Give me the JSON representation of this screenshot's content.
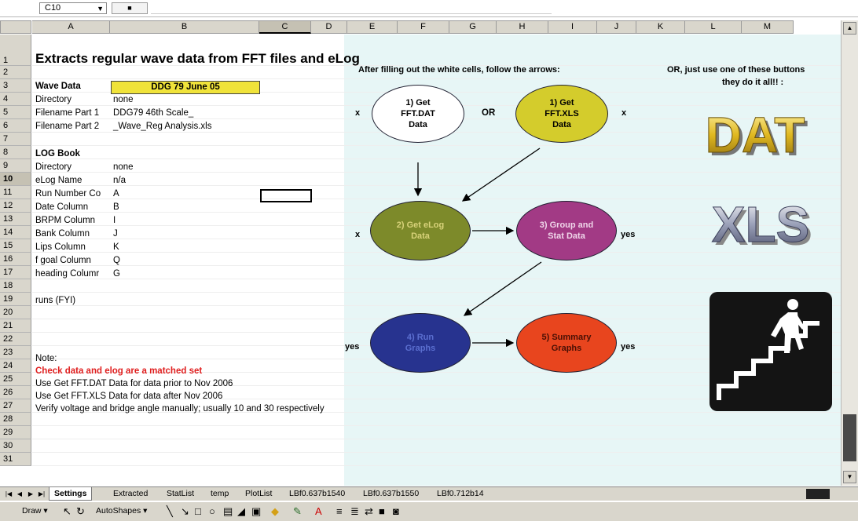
{
  "formula_bar": {
    "name_box": "C10"
  },
  "columns": [
    "A",
    "B",
    "C",
    "D",
    "E",
    "F",
    "G",
    "H",
    "I",
    "J",
    "K",
    "L",
    "M"
  ],
  "rows": [
    "1",
    "2",
    "3",
    "4",
    "5",
    "6",
    "7",
    "8",
    "9",
    "10",
    "11",
    "12",
    "13",
    "14",
    "15",
    "16",
    "17",
    "18",
    "19",
    "20",
    "21",
    "22",
    "23",
    "24",
    "25",
    "26",
    "27",
    "28",
    "29",
    "30",
    "31"
  ],
  "cells": {
    "title": "Extracts regular wave data from FFT files and eLog",
    "wave_data_label": "Wave Data",
    "wave_data_value": "DDG 79 June 05",
    "directory_label": "Directory",
    "directory_value": "none",
    "filename1_label": "Filename Part 1",
    "filename1_value": "DDG79 46th Scale_",
    "filename2_label": "Filename Part 2",
    "filename2_value": "_Wave_Reg Analysis.xls",
    "log_book_label": "LOG Book",
    "log_directory_label": "Directory",
    "log_directory_value": "none",
    "elog_label": "eLog Name",
    "elog_value": "n/a",
    "run_label": "Run Number Co",
    "run_value": "A",
    "date_label": "Date Column",
    "date_value": "B",
    "brpm_label": "BRPM Column",
    "brpm_value": "I",
    "bank_label": "Bank Column",
    "bank_value": "J",
    "lips_label": "Lips Column",
    "lips_value": "K",
    "fgoal_label": "f goal Column",
    "fgoal_value": "Q",
    "heading_label": "heading Columr",
    "heading_value": "G",
    "runs_label": "runs (FYI)",
    "note_label": "Note:",
    "note_red": "Check data and elog are a matched set",
    "note_24": "Use Get FFT.DAT Data for data prior to Nov 2006",
    "note_25": "Use Get FFT.XLS Data for data after Nov 2006",
    "note_26": "Verify voltage and bridge angle manually; usually 10 and 30 respectively"
  },
  "flowchart": {
    "instruction": "After filling out the white cells, follow the arrows:",
    "or_label": "OR",
    "node1a": "1) Get FFT.DAT Data",
    "node1b": "1) Get FFT.XLS Data",
    "node2": "2) Get eLog Data",
    "node3": "3) Group and Stat Data",
    "node4": "4) Run Graphs",
    "node5": "5) Summary Graphs",
    "mark_x1": "x",
    "mark_x2": "x",
    "mark_x3": "x",
    "mark_yes1": "yes",
    "mark_yes2": "yes",
    "mark_yes3": "yes",
    "colors": {
      "node1a": "#ffffff",
      "node1b": "#d4cc2c",
      "node2": "#7d8a2a",
      "node3": "#a23a85",
      "node4": "#27338f",
      "node5": "#e8451e"
    }
  },
  "buttons_panel": {
    "hint_line1": "OR, just use one of these buttons",
    "hint_line2": "they do it all!! :",
    "dat_label": "DAT",
    "xls_label": "XLS",
    "stairs_icon": "stairs-person-icon"
  },
  "sheet_tabs": [
    "Settings",
    "Extracted",
    "StatList",
    "temp",
    "PlotList",
    "LBf0.637b1540",
    "LBf0.637b1550",
    "LBf0.712b14"
  ],
  "toolbar": {
    "draw": "Draw ▾",
    "autoshapes": "AutoShapes ▾"
  }
}
